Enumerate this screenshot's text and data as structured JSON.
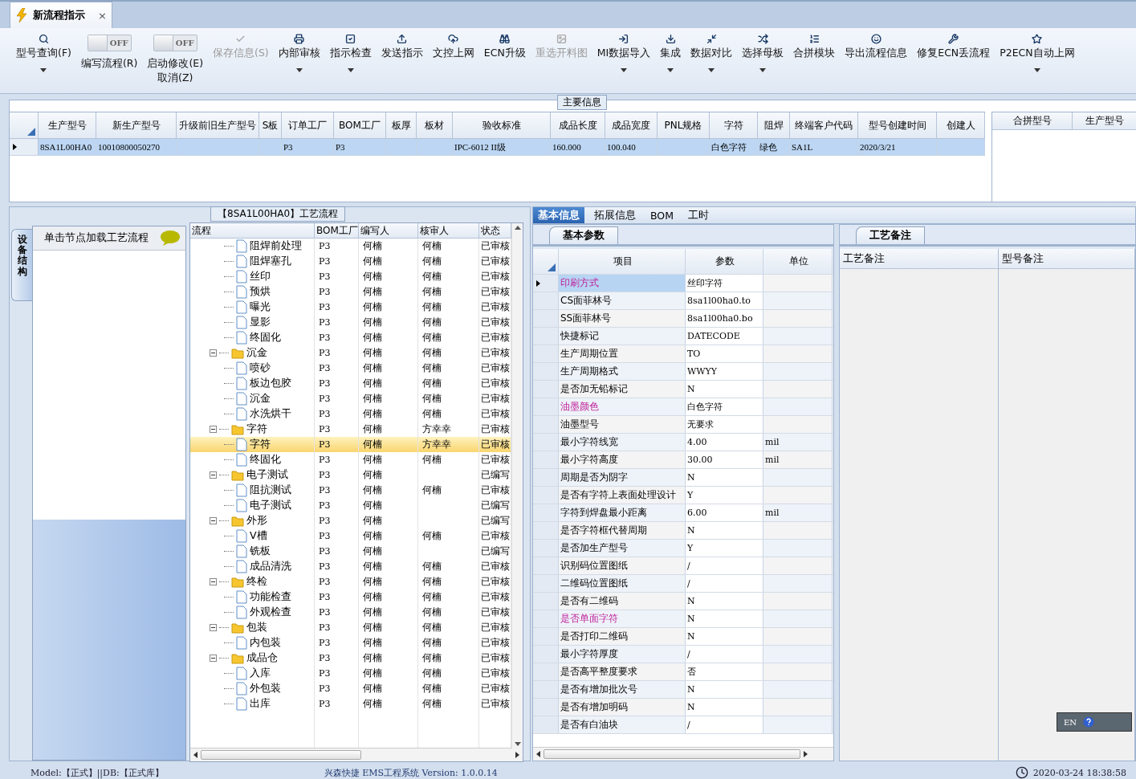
{
  "document_tab": {
    "title": "新流程指示",
    "close": "×"
  },
  "toolbar": [
    {
      "kind": "button",
      "label": "型号查询(F)",
      "dropdown": true,
      "disabled": false
    },
    {
      "kind": "toggle",
      "label": "编写流程(R)",
      "toggle_text": "OFF",
      "on": false
    },
    {
      "kind": "toggle",
      "label": "启动修改(E)",
      "sublabel": "取消(Z)",
      "toggle_text": "OFF",
      "on": false
    },
    {
      "kind": "button",
      "label": "保存信息(S)",
      "dropdown": false,
      "disabled": true
    },
    {
      "kind": "button",
      "label": "内部审核",
      "dropdown": true,
      "disabled": false
    },
    {
      "kind": "button",
      "label": "指示检查",
      "dropdown": true,
      "disabled": false
    },
    {
      "kind": "button",
      "label": "发送指示",
      "dropdown": false,
      "disabled": false
    },
    {
      "kind": "button",
      "label": "文控上网",
      "dropdown": false,
      "disabled": false
    },
    {
      "kind": "button",
      "label": "ECN升级",
      "dropdown": false,
      "disabled": false
    },
    {
      "kind": "button",
      "label": "重选开料图",
      "dropdown": false,
      "disabled": true
    },
    {
      "kind": "button",
      "label": "MI数据导入",
      "dropdown": true,
      "disabled": false
    },
    {
      "kind": "button",
      "label": "集成",
      "dropdown": true,
      "disabled": false
    },
    {
      "kind": "button",
      "label": "数据对比",
      "dropdown": true,
      "disabled": false
    },
    {
      "kind": "button",
      "label": "选择母板",
      "dropdown": true,
      "disabled": false
    },
    {
      "kind": "button",
      "label": "合拼模块",
      "dropdown": false,
      "disabled": false
    },
    {
      "kind": "button",
      "label": "导出流程信息",
      "dropdown": false,
      "disabled": false
    },
    {
      "kind": "button",
      "label": "修复ECN丢流程",
      "dropdown": false,
      "disabled": false
    },
    {
      "kind": "button",
      "label": "P2ECN自动上网",
      "dropdown": true,
      "disabled": false
    }
  ],
  "main_info": {
    "title": "主要信息",
    "columns": [
      "生产型号",
      "新生产型号",
      "升级前旧生产型号",
      "S板",
      "订单工厂",
      "BOM工厂",
      "板厚",
      "板材",
      "验收标准",
      "成品长度",
      "成品宽度",
      "PNL规格",
      "字符",
      "阻焊",
      "终端客户代码",
      "型号创建时间",
      "创建人"
    ],
    "rows": [
      {
        "selected": true,
        "cells": [
          "8SA1L00HA0",
          "10010800050270",
          null,
          null,
          "P3",
          "P3",
          null,
          null,
          "IPC-6012 II级",
          "160.000",
          "100.040",
          null,
          "白色字符",
          "绿色",
          "SA1L",
          "2020/3/21",
          null
        ]
      }
    ],
    "merge_columns": [
      "合拼型号",
      "生产型号"
    ]
  },
  "process": {
    "title": "【8SA1L00HA0】工艺流程",
    "side_tab": "设备结构",
    "hint": "单击节点加载工艺流程",
    "columns": [
      "流程",
      "BOM工厂",
      "编写人",
      "核审人",
      "状态"
    ],
    "tree": [
      {
        "children": [
          {
            "name": "阻焊前处理",
            "bom": "P3",
            "writer": "何楠",
            "reviewer": "何楠",
            "status": "已审核",
            "selected": false
          },
          {
            "name": "阻焊塞孔",
            "bom": "P3",
            "writer": "何楠",
            "reviewer": "何楠",
            "status": "已审核",
            "selected": false
          },
          {
            "name": "丝印",
            "bom": "P3",
            "writer": "何楠",
            "reviewer": "何楠",
            "status": "已审核",
            "selected": false
          },
          {
            "name": "预烘",
            "bom": "P3",
            "writer": "何楠",
            "reviewer": "何楠",
            "status": "已审核",
            "selected": false
          },
          {
            "name": "曝光",
            "bom": "P3",
            "writer": "何楠",
            "reviewer": "何楠",
            "status": "已审核",
            "selected": false
          },
          {
            "name": "显影",
            "bom": "P3",
            "writer": "何楠",
            "reviewer": "何楠",
            "status": "已审核",
            "selected": false
          },
          {
            "name": "终固化",
            "bom": "P3",
            "writer": "何楠",
            "reviewer": "何楠",
            "status": "已审核",
            "selected": false
          }
        ]
      },
      {
        "name": "沉金",
        "bom": "P3",
        "writer": "何楠",
        "reviewer": "何楠",
        "status": "已审核",
        "selected": false,
        "expanded": true,
        "children": [
          {
            "name": "喷砂",
            "bom": "P3",
            "writer": "何楠",
            "reviewer": "何楠",
            "status": "已审核",
            "selected": false
          },
          {
            "name": "板边包胶",
            "bom": "P3",
            "writer": "何楠",
            "reviewer": "何楠",
            "status": "已审核",
            "selected": false
          },
          {
            "name": "沉金",
            "bom": "P3",
            "writer": "何楠",
            "reviewer": "何楠",
            "status": "已审核",
            "selected": false
          },
          {
            "name": "水洗烘干",
            "bom": "P3",
            "writer": "何楠",
            "reviewer": "何楠",
            "status": "已审核",
            "selected": false
          }
        ]
      },
      {
        "name": "字符",
        "bom": "P3",
        "writer": "何楠",
        "reviewer": "方幸幸",
        "status": "已审核",
        "selected": false,
        "expanded": true,
        "children": [
          {
            "name": "字符",
            "bom": "P3",
            "writer": "何楠",
            "reviewer": "方幸幸",
            "status": "已审核",
            "selected": true
          },
          {
            "name": "终固化",
            "bom": "P3",
            "writer": "何楠",
            "reviewer": "何楠",
            "status": "已审核",
            "selected": false
          }
        ]
      },
      {
        "name": "电子测试",
        "bom": "P3",
        "writer": "何楠",
        "status": "已编写",
        "selected": false,
        "expanded": true,
        "children": [
          {
            "name": "阻抗测试",
            "bom": "P3",
            "writer": "何楠",
            "reviewer": "何楠",
            "status": "已审核",
            "selected": false
          },
          {
            "name": "电子测试",
            "bom": "P3",
            "writer": "何楠",
            "status": "已编写",
            "selected": false
          }
        ]
      },
      {
        "name": "外形",
        "bom": "P3",
        "writer": "何楠",
        "status": "已编写",
        "selected": false,
        "expanded": true,
        "children": [
          {
            "name": "V槽",
            "bom": "P3",
            "writer": "何楠",
            "reviewer": "何楠",
            "status": "已审核",
            "selected": false
          },
          {
            "name": "铣板",
            "bom": "P3",
            "writer": "何楠",
            "status": "已编写",
            "selected": false
          },
          {
            "name": "成品清洗",
            "bom": "P3",
            "writer": "何楠",
            "reviewer": "何楠",
            "status": "已审核",
            "selected": false
          }
        ]
      },
      {
        "name": "终检",
        "bom": "P3",
        "writer": "何楠",
        "reviewer": "何楠",
        "status": "已审核",
        "selected": false,
        "expanded": true,
        "children": [
          {
            "name": "功能检查",
            "bom": "P3",
            "writer": "何楠",
            "reviewer": "何楠",
            "status": "已审核",
            "selected": false
          },
          {
            "name": "外观检查",
            "bom": "P3",
            "writer": "何楠",
            "reviewer": "何楠",
            "status": "已审核",
            "selected": false
          }
        ]
      },
      {
        "name": "包装",
        "bom": "P3",
        "writer": "何楠",
        "reviewer": "何楠",
        "status": "已审核",
        "selected": false,
        "expanded": true,
        "children": [
          {
            "name": "内包装",
            "bom": "P3",
            "writer": "何楠",
            "reviewer": "何楠",
            "status": "已审核",
            "selected": false
          }
        ]
      },
      {
        "name": "成品仓",
        "bom": "P3",
        "writer": "何楠",
        "reviewer": "何楠",
        "status": "已审核",
        "selected": false,
        "expanded": true,
        "children": [
          {
            "name": "入库",
            "bom": "P3",
            "writer": "何楠",
            "reviewer": "何楠",
            "status": "已审核",
            "selected": false
          },
          {
            "name": "外包装",
            "bom": "P3",
            "writer": "何楠",
            "reviewer": "何楠",
            "status": "已审核",
            "selected": false
          },
          {
            "name": "出库",
            "bom": "P3",
            "writer": "何楠",
            "reviewer": "何楠",
            "status": "已审核",
            "selected": false
          }
        ]
      }
    ]
  },
  "detail": {
    "tabs": [
      {
        "label": "基本信息",
        "selected": true
      },
      {
        "label": "拓展信息",
        "selected": false
      },
      {
        "label": "BOM",
        "selected": false
      },
      {
        "label": "工时",
        "selected": false
      }
    ],
    "sub_tab": "基本参数",
    "columns": [
      "项目",
      "参数",
      "单位"
    ],
    "rows": [
      {
        "item": "印刷方式",
        "value": "丝印字符",
        "highlight": true,
        "selected": true
      },
      {
        "item": "CS面菲林号",
        "value": "8sa1l00ha0.to",
        "highlight": false,
        "selected": false
      },
      {
        "item": "SS面菲林号",
        "value": "8sa1l00ha0.bo",
        "highlight": false,
        "selected": false
      },
      {
        "item": "快捷标记",
        "value": "DATECODE",
        "highlight": false,
        "selected": false
      },
      {
        "item": "生产周期位置",
        "value": "TO",
        "highlight": false,
        "selected": false
      },
      {
        "item": "生产周期格式",
        "value": "WWYY",
        "highlight": false,
        "selected": false
      },
      {
        "item": "是否加无铅标记",
        "value": "N",
        "highlight": false,
        "selected": false
      },
      {
        "item": "油墨颜色",
        "value": "白色字符",
        "highlight": true,
        "selected": false
      },
      {
        "item": "油墨型号",
        "value": "无要求",
        "highlight": false,
        "selected": false
      },
      {
        "item": "最小字符线宽",
        "value": "4.00",
        "unit": "mil",
        "highlight": false,
        "selected": false
      },
      {
        "item": "最小字符高度",
        "value": "30.00",
        "unit": "mil",
        "highlight": false,
        "selected": false
      },
      {
        "item": "周期是否为阴字",
        "value": "N",
        "highlight": false,
        "selected": false
      },
      {
        "item": "是否有字符上表面处理设计",
        "value": "Y",
        "highlight": false,
        "selected": false
      },
      {
        "item": "字符到焊盘最小距离",
        "value": "6.00",
        "unit": "mil",
        "highlight": false,
        "selected": false
      },
      {
        "item": "是否字符框代替周期",
        "value": "N",
        "highlight": false,
        "selected": false
      },
      {
        "item": "是否加生产型号",
        "value": "Y",
        "highlight": false,
        "selected": false
      },
      {
        "item": "识别码位置图纸",
        "value": "/",
        "highlight": false,
        "selected": false
      },
      {
        "item": "二维码位置图纸",
        "value": "/",
        "highlight": false,
        "selected": false
      },
      {
        "item": "是否有二维码",
        "value": "N",
        "highlight": false,
        "selected": false
      },
      {
        "item": "是否单面字符",
        "value": "N",
        "highlight": true,
        "selected": false
      },
      {
        "item": "是否打印二维码",
        "value": "N",
        "highlight": false,
        "selected": false
      },
      {
        "item": "最小字符厚度",
        "value": "/",
        "highlight": false,
        "selected": false
      },
      {
        "item": "是否高平整度要求",
        "value": "否",
        "highlight": false,
        "selected": false
      },
      {
        "item": "是否有增加批次号",
        "value": "N",
        "highlight": false,
        "selected": false
      },
      {
        "item": "是否有增加明码",
        "value": "N",
        "highlight": false,
        "selected": false
      },
      {
        "item": "是否有白油块",
        "value": "/",
        "highlight": false,
        "selected": false
      }
    ]
  },
  "notes": {
    "tab": "工艺备注",
    "columns": [
      "工艺备注",
      "型号备注"
    ]
  },
  "ime": {
    "label": "EN"
  },
  "status_bar": {
    "left": "Model:【正式】||DB:【正式库】",
    "center": "兴森快捷 EMS工程系统 Version: 1.0.0.14",
    "time": "2020-03-24 18:38:58"
  }
}
